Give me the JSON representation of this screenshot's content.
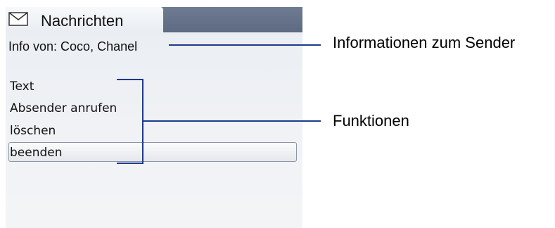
{
  "header": {
    "tab_title": "Nachrichten",
    "tab_icon": "envelope-icon"
  },
  "info": {
    "text": "Info von: Coco, Chanel"
  },
  "menu": {
    "items": [
      {
        "label": "Text",
        "selected": false
      },
      {
        "label": "Absender anrufen",
        "selected": false
      },
      {
        "label": "löschen",
        "selected": false
      },
      {
        "label": "beenden",
        "selected": true
      }
    ]
  },
  "annotations": {
    "sender_info": "Informationen zum Sender",
    "functions": "Funktionen"
  },
  "colors": {
    "header_bar": "#5d6a82",
    "screen_bg": "#eef1f4",
    "callout_line": "#1f3a8a"
  }
}
